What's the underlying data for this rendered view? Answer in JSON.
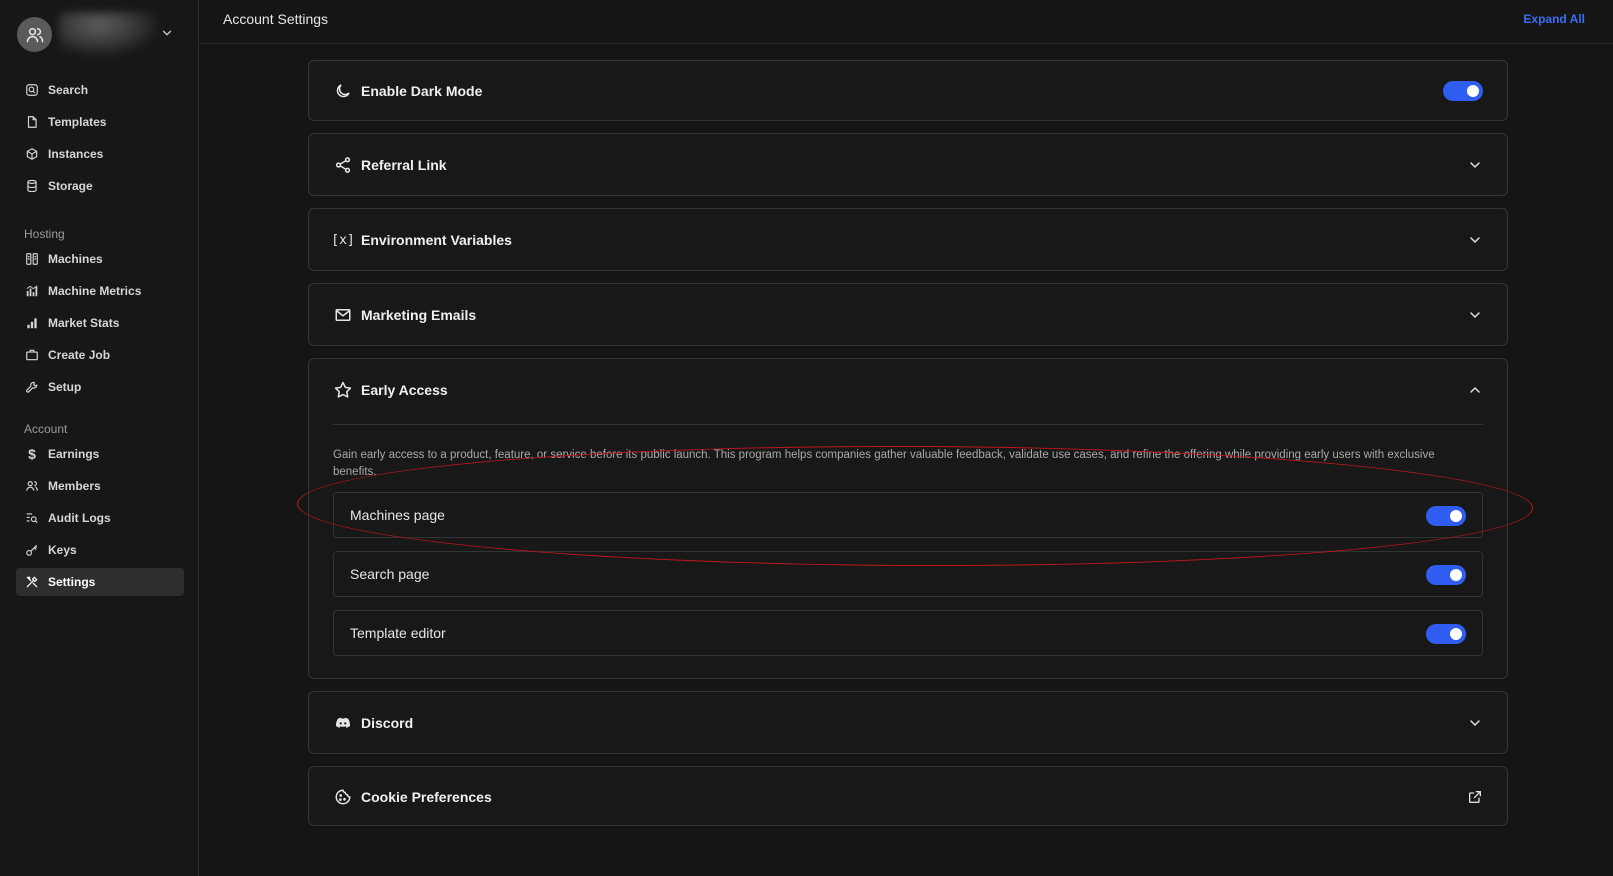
{
  "header": {
    "title": "Account Settings",
    "expand_all": "Expand All"
  },
  "sidebar": {
    "main_items": [
      {
        "label": "Search",
        "icon": "search-icon"
      },
      {
        "label": "Templates",
        "icon": "file-icon"
      },
      {
        "label": "Instances",
        "icon": "cube-icon"
      },
      {
        "label": "Storage",
        "icon": "database-icon"
      }
    ],
    "hosting_label": "Hosting",
    "hosting_items": [
      {
        "label": "Machines",
        "icon": "server-icon"
      },
      {
        "label": "Machine Metrics",
        "icon": "bar-chart-icon"
      },
      {
        "label": "Market Stats",
        "icon": "signal-icon"
      },
      {
        "label": "Create Job",
        "icon": "briefcase-icon"
      },
      {
        "label": "Setup",
        "icon": "wrench-icon"
      }
    ],
    "account_label": "Account",
    "account_items": [
      {
        "label": "Earnings",
        "icon": "dollar-icon"
      },
      {
        "label": "Members",
        "icon": "users-icon"
      },
      {
        "label": "Audit Logs",
        "icon": "list-search-icon"
      },
      {
        "label": "Keys",
        "icon": "key-icon"
      },
      {
        "label": "Settings",
        "icon": "tools-icon",
        "active": true
      }
    ]
  },
  "panels": {
    "dark_mode": {
      "title": "Enable Dark Mode",
      "enabled": true
    },
    "referral": {
      "title": "Referral Link"
    },
    "env_vars": {
      "title": "Environment Variables",
      "icon_text": "[x]"
    },
    "marketing": {
      "title": "Marketing Emails"
    },
    "early_access": {
      "title": "Early Access",
      "description": "Gain early access to a product, feature, or service before its public launch. This program helps companies gather valuable feedback, validate use cases, and refine the offering while providing early users with exclusive benefits.",
      "features": [
        {
          "label": "Machines page",
          "enabled": true
        },
        {
          "label": "Search page",
          "enabled": true
        },
        {
          "label": "Template editor",
          "enabled": true
        }
      ]
    },
    "discord": {
      "title": "Discord"
    },
    "cookies": {
      "title": "Cookie Preferences"
    }
  },
  "colors": {
    "accent": "#2f5df2",
    "link": "#3a6ff2",
    "annotation": "#c0161d"
  }
}
